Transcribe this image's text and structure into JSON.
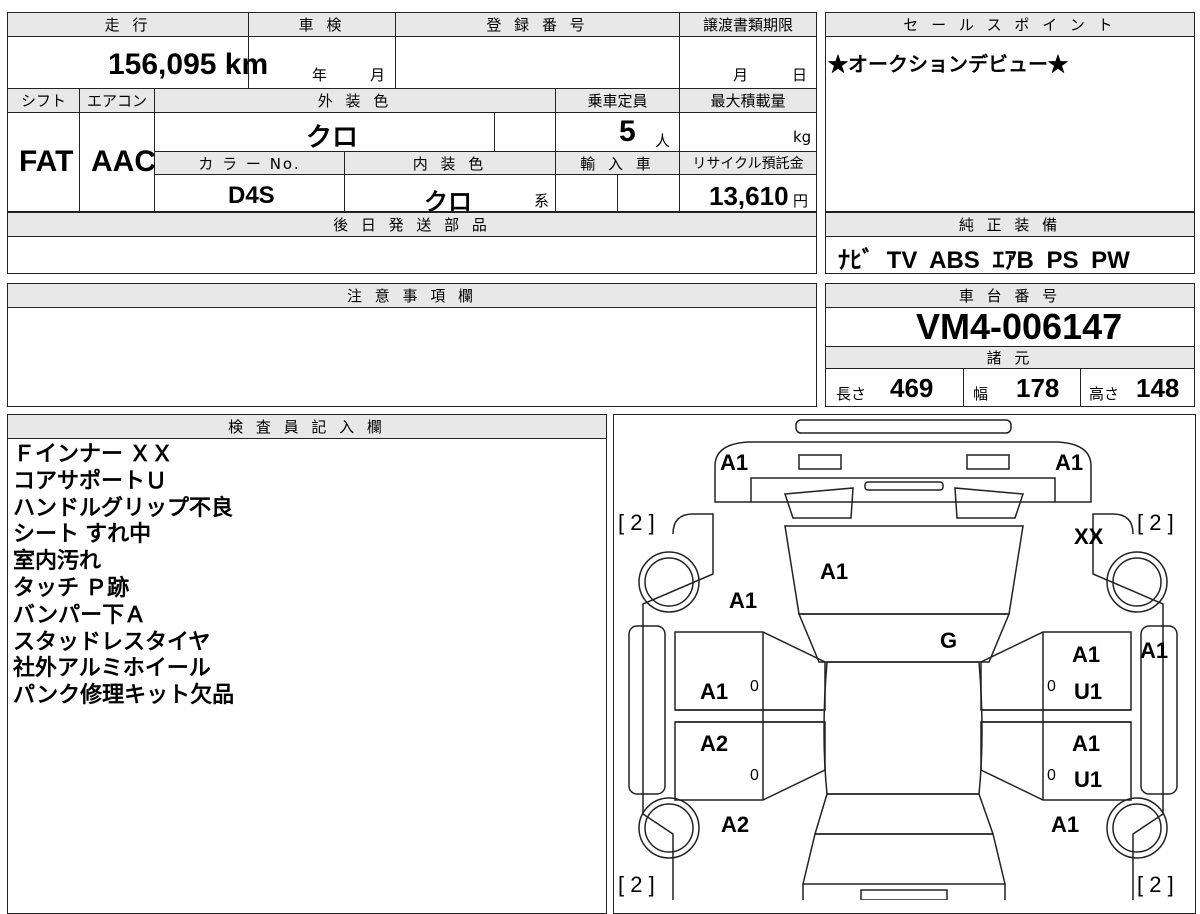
{
  "top": {
    "mileage_label": "走 行",
    "mileage_value": "156,095 km",
    "shaken_label": "車 検",
    "shaken_year": "年",
    "shaken_month": "月",
    "reg_label": "登 録 番 号",
    "deadline_label": "譲渡書類期限",
    "deadline_month": "月",
    "deadline_day": "日",
    "shift_label": "シフト",
    "ac_label": "エアコン",
    "ext_color_label": "外 装 色",
    "seats_label": "乗車定員",
    "maxload_label": "最大積載量",
    "shift_value": "FAT",
    "ac_value": "AAC",
    "ext_color_value": "クロ",
    "seats_value": "5",
    "seats_unit": "人",
    "maxload_unit": "kg",
    "colorno_label": "カ ラ ー No.",
    "int_color_label": "内 装 色",
    "import_label": "輸 入 車",
    "recycle_label": "リサイクル預託金",
    "colorno_value": "D4S",
    "int_color_value": "クロ",
    "int_color_suffix": "系",
    "recycle_value": "13,610",
    "recycle_unit": "円",
    "later_parts_label": "後 日 発 送 部 品"
  },
  "sales": {
    "label": "セ ー ル ス ポ イ ン ト",
    "text": "★オークションデビュー★"
  },
  "equipment": {
    "label": "純 正 装 備",
    "value": "ﾅﾋﾞ TV ABS ｴｱB PS PW"
  },
  "notes": {
    "label": "注 意 事 項 欄"
  },
  "chassis": {
    "label": "車 台 番 号",
    "value": "VM4-006147",
    "spec_label": "諸 元",
    "length_label": "長さ",
    "length_value": "469",
    "width_label": "幅",
    "width_value": "178",
    "height_label": "高さ",
    "height_value": "148"
  },
  "inspector": {
    "label": "検 査 員 記 入 欄",
    "lines": [
      "Ｆインナー ＸＸ",
      "コアサポートＵ",
      "ハンドルグリップ不良",
      "シート すれ中",
      "室内汚れ",
      "タッチ Ｐ跡",
      "バンパー下Ａ",
      "スタッドレスタイヤ",
      "社外アルミホイール",
      "パンク修理キット欠品"
    ]
  },
  "diagram": {
    "marks": {
      "front_left": "A1",
      "front_right": "A1",
      "tire_fl": "[ 2 ]",
      "tire_fr": "[ 2 ]",
      "fender_fr": "XX",
      "hood": "A1",
      "fender_fl": "A1",
      "roof": "G",
      "door_rf_top": "A1",
      "pillar_right": "A1",
      "door_lf": "A1",
      "door_lf_zero": "0",
      "door_rf_zero": "0",
      "door_rf": "U1",
      "door_lr": "A2",
      "door_lr_zero": "0",
      "door_rr_top": "A1",
      "door_rr_zero": "0",
      "door_rr": "U1",
      "quarter_l": "A2",
      "quarter_r": "A1",
      "tire_rl": "[ 2 ]",
      "tire_rr": "[ 2 ]"
    }
  }
}
